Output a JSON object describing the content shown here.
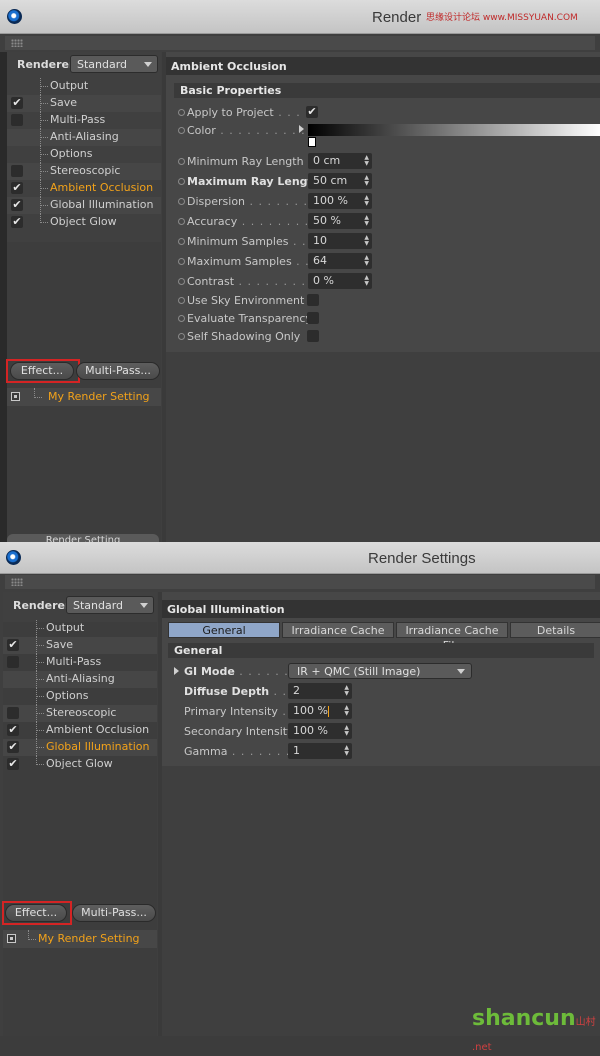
{
  "window1": {
    "title": "Render",
    "watermark": "思缘设计论坛 www.MISSYUAN.COM",
    "renderer": {
      "label": "Renderer",
      "value": "Standard"
    },
    "tree": [
      {
        "label": "Output",
        "checked": null
      },
      {
        "label": "Save",
        "checked": true
      },
      {
        "label": "Multi-Pass",
        "checked": false
      },
      {
        "label": "Anti-Aliasing",
        "checked": null
      },
      {
        "label": "Options",
        "checked": null
      },
      {
        "label": "Stereoscopic",
        "checked": false
      },
      {
        "label": "Ambient Occlusion",
        "checked": true,
        "active": true
      },
      {
        "label": "Global Illumination",
        "checked": true
      },
      {
        "label": "Object Glow",
        "checked": true
      }
    ],
    "effect_button": "Effect...",
    "multipass_button": "Multi-Pass...",
    "render_setting": "My Render Setting",
    "bottom_tab": "Render Setting",
    "panel_title": "Ambient Occlusion",
    "sub_title": "Basic Properties",
    "props": {
      "apply_to_project": {
        "name": "Apply to Project",
        "dots": " . . . . .",
        "check": "✔"
      },
      "color": {
        "name": "Color",
        "dots": " . . . . . . . . . . . ."
      },
      "min_ray": {
        "name": "Minimum Ray Length",
        "value": "0 cm"
      },
      "max_ray": {
        "name": "Maximum Ray Length",
        "value": "50 cm"
      },
      "dispersion": {
        "name": "Dispersion",
        "dots": " . . . . . . . . .",
        "value": "100 %"
      },
      "accuracy": {
        "name": "Accuracy",
        "dots": " . . . . . . . . . . .",
        "value": "50 %"
      },
      "min_samples": {
        "name": "Minimum Samples",
        "dots": " . . .",
        "value": "10"
      },
      "max_samples": {
        "name": "Maximum Samples",
        "dots": " . . .",
        "value": "64"
      },
      "contrast": {
        "name": "Contrast",
        "dots": " . . . . . . . . . . .",
        "value": "0 %"
      },
      "use_sky": {
        "name": "Use Sky Environment"
      },
      "eval_transp": {
        "name": "Evaluate Transparency"
      },
      "self_shadow": {
        "name": "Self Shadowing Only"
      }
    }
  },
  "window2": {
    "title": "Render Settings",
    "renderer": {
      "label": "Renderer",
      "value": "Standard"
    },
    "tree": [
      {
        "label": "Output",
        "checked": null
      },
      {
        "label": "Save",
        "checked": true
      },
      {
        "label": "Multi-Pass",
        "checked": false
      },
      {
        "label": "Anti-Aliasing",
        "checked": null
      },
      {
        "label": "Options",
        "checked": null
      },
      {
        "label": "Stereoscopic",
        "checked": false
      },
      {
        "label": "Ambient Occlusion",
        "checked": true
      },
      {
        "label": "Global Illumination",
        "checked": true,
        "active": true
      },
      {
        "label": "Object Glow",
        "checked": true
      }
    ],
    "effect_button": "Effect...",
    "multipass_button": "Multi-Pass...",
    "render_setting": "My Render Setting",
    "panel_title": "Global Illumination",
    "tabs": [
      "General",
      "Irradiance Cache",
      "Irradiance Cache File",
      "Details"
    ],
    "sub_title": "General",
    "props": {
      "gi_mode": {
        "name": "GI Mode",
        "dots": " . . . . . . . . .",
        "value": "IR + QMC (Still Image)"
      },
      "diffuse_depth": {
        "name": "Diffuse Depth",
        "dots": " . . . . .",
        "value": "2"
      },
      "primary": {
        "name": "Primary Intensity",
        "dots": " . . .",
        "value": "100 %"
      },
      "secondary": {
        "name": "Secondary Intensity",
        "value": "100 %"
      },
      "gamma": {
        "name": "Gamma",
        "dots": " . . . . . . . . . . . .",
        "value": "1"
      }
    }
  },
  "footer": {
    "brand": "shancun",
    "suffix": "山村 .net"
  },
  "colors": {
    "accent": "#f2a21a",
    "highlight_box": "#d42424",
    "tab_active": "#8fa6c8"
  }
}
